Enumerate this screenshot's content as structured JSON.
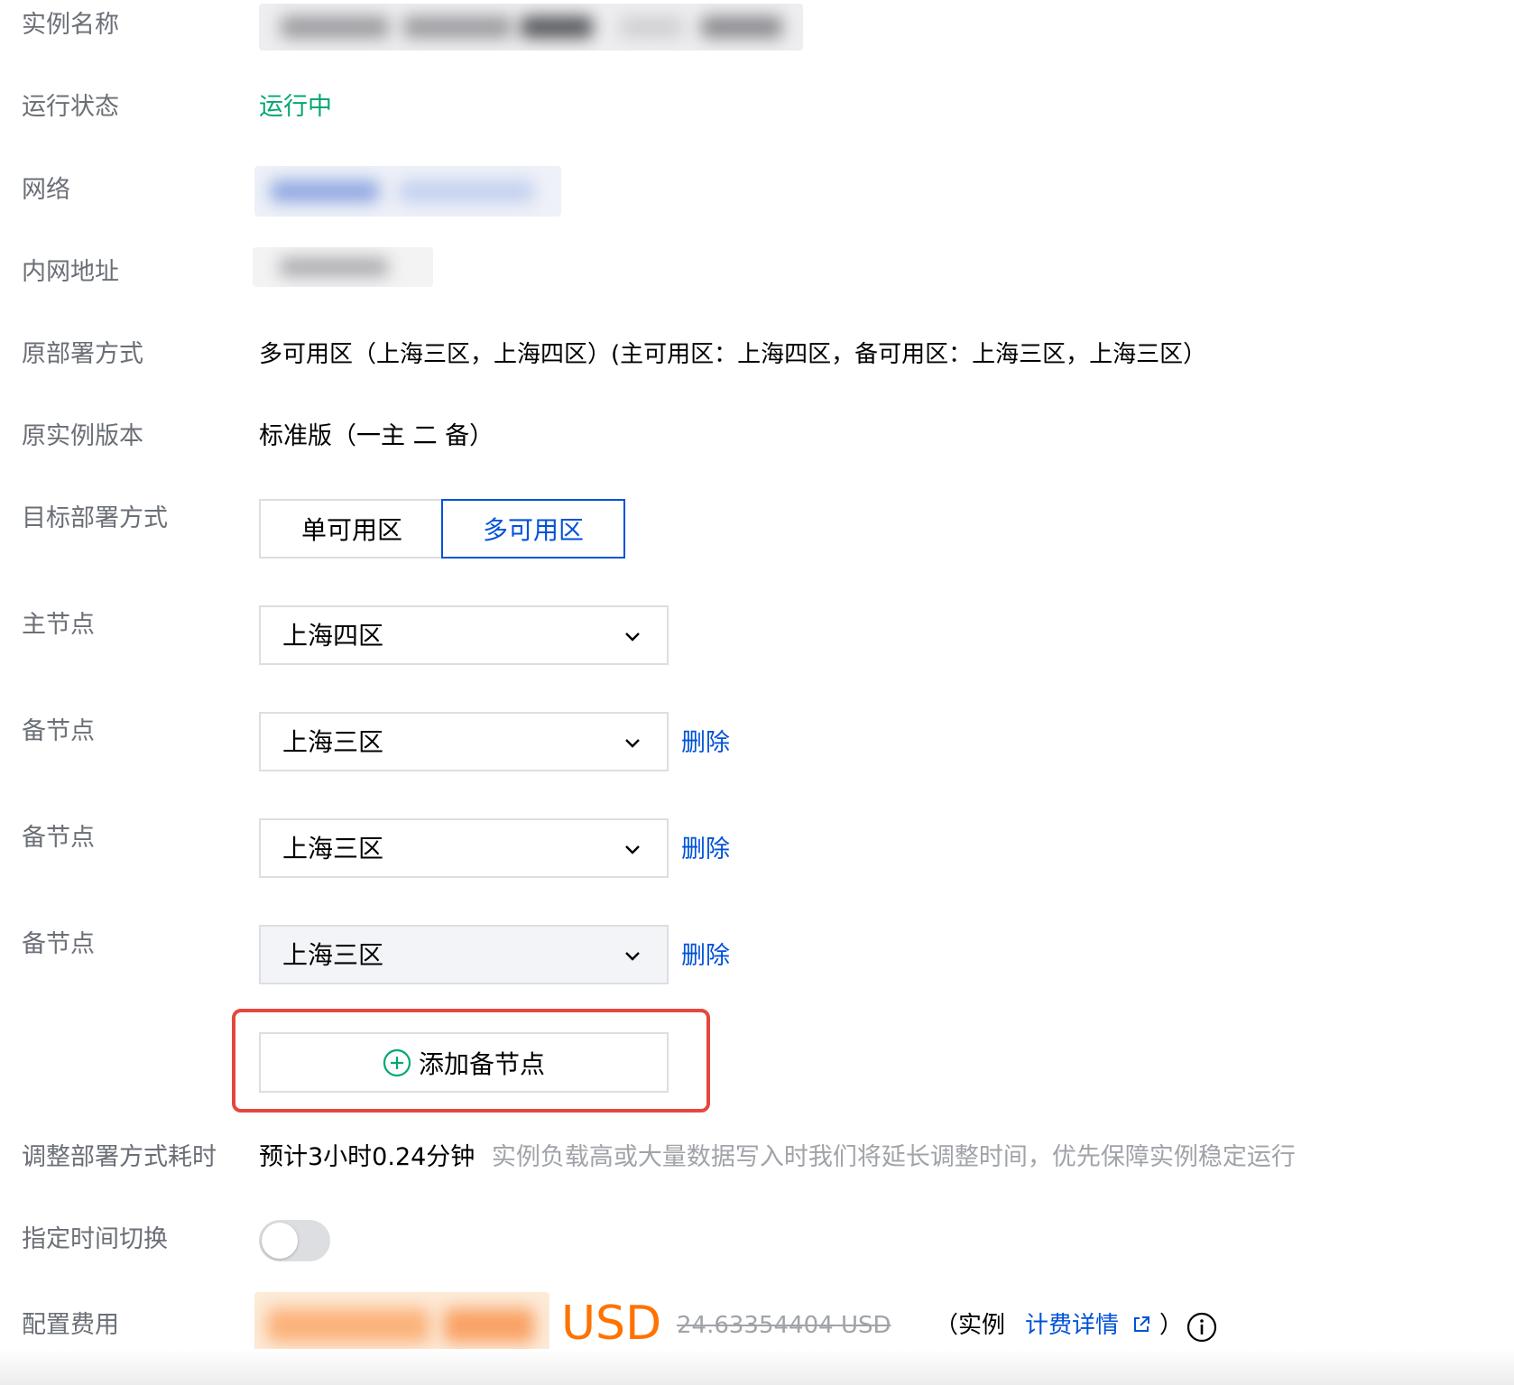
{
  "rows": {
    "instance_name": {
      "label": "实例名称"
    },
    "run_status": {
      "label": "运行状态",
      "value": "运行中",
      "color": "#00a870"
    },
    "network": {
      "label": "网络"
    },
    "private_ip": {
      "label": "内网地址"
    },
    "orig_deploy": {
      "label": "原部署方式",
      "value": "多可用区（上海三区，上海四区）(主可用区：上海四区，备可用区：上海三区，上海三区）"
    },
    "orig_version": {
      "label": "原实例版本",
      "value": "标准版（一主 二 备）"
    },
    "target_deploy": {
      "label": "目标部署方式",
      "options": [
        "单可用区",
        "多可用区"
      ],
      "selected": "多可用区"
    },
    "master_node": {
      "label": "主节点",
      "value": "上海四区"
    },
    "standby_nodes": [
      {
        "label": "备节点",
        "value": "上海三区",
        "action": "删除"
      },
      {
        "label": "备节点",
        "value": "上海三区",
        "action": "删除"
      },
      {
        "label": "备节点",
        "value": "上海三区",
        "action": "删除"
      }
    ],
    "add_standby": {
      "label": "添加备节点",
      "icon": "plus-circle-icon",
      "icon_color": "#00a870"
    },
    "adjust_time": {
      "label": "调整部署方式耗时",
      "value": "预计3小时0.24分钟",
      "hint": "实例负载高或大量数据写入时我们将延长调整时间，优先保障实例稳定运行"
    },
    "scheduled_switch": {
      "label": "指定时间切换",
      "enabled": false
    },
    "config_fee": {
      "label": "配置费用",
      "currency": "USD",
      "currency_color": "#ff7200",
      "original_price": "24.63354404 USD",
      "note_prefix": "（实例",
      "billing_link": "计费详情",
      "note_suffix": "）",
      "icons": [
        "external-link-icon",
        "info-icon"
      ]
    }
  },
  "colors": {
    "accent": "#0052d9",
    "highlight_border": "#e5473e",
    "label": "#6b6f76"
  }
}
